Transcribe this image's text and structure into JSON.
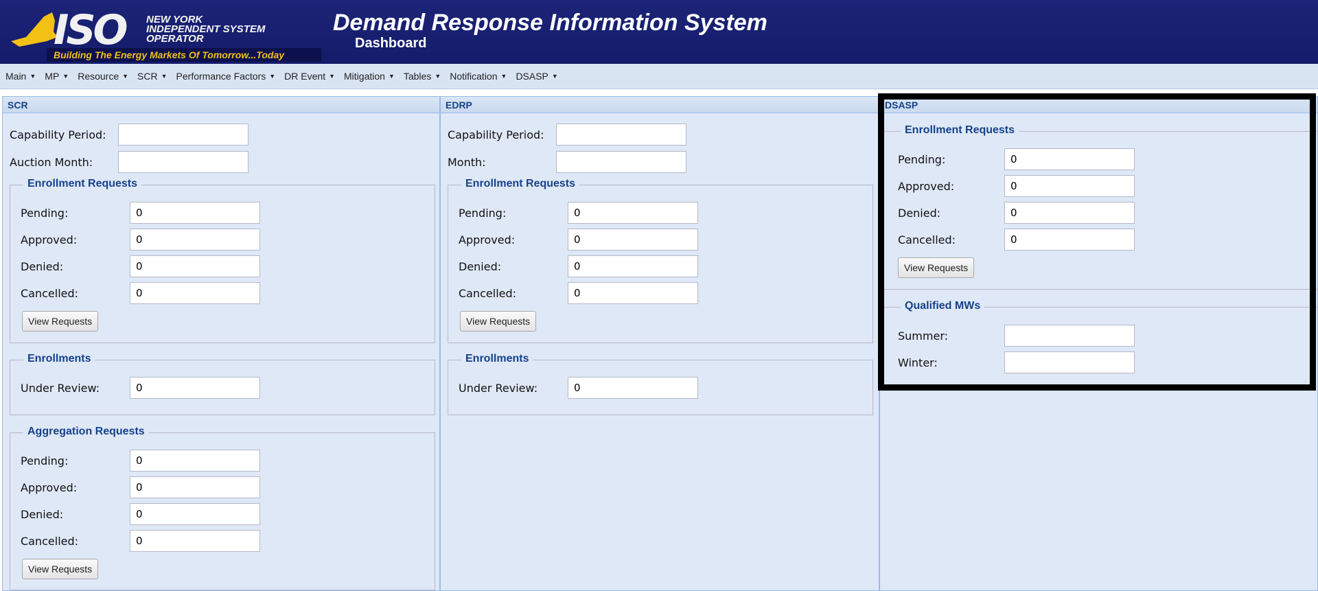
{
  "header": {
    "logo_iso": "ISO",
    "logo_org": "NEW YORK INDEPENDENT SYSTEM OPERATOR",
    "logo_tagline": "Building The Energy Markets Of Tomorrow...Today",
    "title": "Demand Response Information System",
    "subtitle": "Dashboard",
    "brand_color": "#1a2272",
    "accent_color": "#f3c014"
  },
  "menu": {
    "items": [
      {
        "label": "Main"
      },
      {
        "label": "MP"
      },
      {
        "label": "Resource"
      },
      {
        "label": "SCR"
      },
      {
        "label": "Performance Factors"
      },
      {
        "label": "DR Event"
      },
      {
        "label": "Mitigation"
      },
      {
        "label": "Tables"
      },
      {
        "label": "Notification"
      },
      {
        "label": "DSASP"
      }
    ],
    "caret": "▼"
  },
  "scr": {
    "title": "SCR",
    "capability_period_label": "Capability Period:",
    "capability_period_value": "",
    "auction_month_label": "Auction Month:",
    "auction_month_value": "",
    "enrollment_requests": {
      "legend": "Enrollment Requests",
      "pending_label": "Pending:",
      "pending_value": "0",
      "approved_label": "Approved:",
      "approved_value": "0",
      "denied_label": "Denied:",
      "denied_value": "0",
      "cancelled_label": "Cancelled:",
      "cancelled_value": "0",
      "button": "View Requests"
    },
    "enrollments": {
      "legend": "Enrollments",
      "under_review_label": "Under Review:",
      "under_review_value": "0"
    },
    "aggregation_requests": {
      "legend": "Aggregation Requests",
      "pending_label": "Pending:",
      "pending_value": "0",
      "approved_label": "Approved:",
      "approved_value": "0",
      "denied_label": "Denied:",
      "denied_value": "0",
      "cancelled_label": "Cancelled:",
      "cancelled_value": "0",
      "button": "View Requests"
    }
  },
  "edrp": {
    "title": "EDRP",
    "capability_period_label": "Capability Period:",
    "capability_period_value": "",
    "month_label": "Month:",
    "month_value": "",
    "enrollment_requests": {
      "legend": "Enrollment Requests",
      "pending_label": "Pending:",
      "pending_value": "0",
      "approved_label": "Approved:",
      "approved_value": "0",
      "denied_label": "Denied:",
      "denied_value": "0",
      "cancelled_label": "Cancelled:",
      "cancelled_value": "0",
      "button": "View Requests"
    },
    "enrollments": {
      "legend": "Enrollments",
      "under_review_label": "Under Review:",
      "under_review_value": "0"
    }
  },
  "dsasp": {
    "title": "DSASP",
    "enrollment_requests": {
      "legend": "Enrollment Requests",
      "pending_label": "Pending:",
      "pending_value": "0",
      "approved_label": "Approved:",
      "approved_value": "0",
      "denied_label": "Denied:",
      "denied_value": "0",
      "cancelled_label": "Cancelled:",
      "cancelled_value": "0",
      "button": "View Requests"
    },
    "qualified_mws": {
      "legend": "Qualified MWs",
      "summer_label": "Summer:",
      "summer_value": "",
      "winter_label": "Winter:",
      "winter_value": ""
    }
  }
}
